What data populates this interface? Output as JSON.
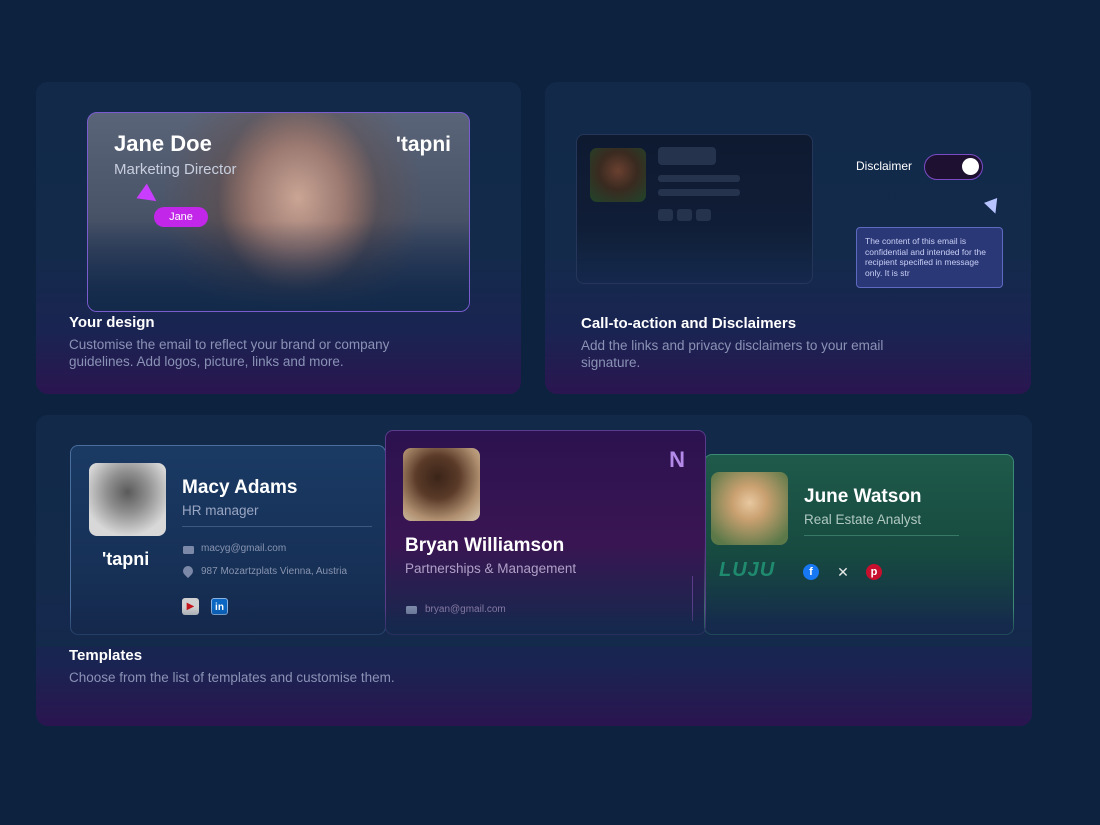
{
  "design_panel": {
    "card": {
      "name": "Jane Doe",
      "role": "Marketing Director",
      "logo": "'tapni",
      "cursor_tag": "Jane"
    },
    "title": "Your design",
    "description": "Customise the email to reflect your brand or company guidelines. Add logos,  picture, links and more."
  },
  "cta_panel": {
    "toggle_label": "Disclaimer",
    "toggle_on": true,
    "disclaimer_text": "The content of this email is confidential and intended for the recipient specified in message only. It is str",
    "title": "Call-to-action and Disclaimers",
    "description": "Add the links and privacy disclaimers to your email signature."
  },
  "templates_panel": {
    "title": "Templates",
    "description": "Choose from the list of templates and customise them.",
    "cards": [
      {
        "name": "Macy Adams",
        "role": "HR manager",
        "logo": "'tapni",
        "email": "macyg@gmail.com",
        "address": "987 Mozartzplats Vienna, Austria",
        "socials": [
          "youtube-icon",
          "linkedin-icon"
        ]
      },
      {
        "name": "Bryan Williamson",
        "role": "Partnerships & Management",
        "email": "bryan@gmail.com",
        "logo": "N"
      },
      {
        "name": "June Watson",
        "role": "Real Estate Analyst",
        "logo": "LUJU",
        "socials": [
          "facebook-icon",
          "x-icon",
          "pinterest-icon"
        ]
      }
    ]
  },
  "colors": {
    "background": "#0d223f",
    "accent_purple": "#c226e8",
    "toggle_border": "#7b4bc6"
  }
}
